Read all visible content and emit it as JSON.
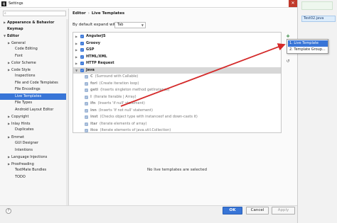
{
  "window": {
    "title": "Settings",
    "app_icon": "IJ"
  },
  "background_tab": {
    "label": "Test02.java"
  },
  "sidebar": {
    "search_placeholder": "",
    "items": [
      {
        "label": "Appearance & Behavior",
        "arrow": "▶",
        "bold": true
      },
      {
        "label": "Keymap",
        "arrow": "",
        "bold": true
      },
      {
        "label": "Editor",
        "arrow": "▼",
        "bold": true
      },
      {
        "label": "General",
        "arrow": "▶",
        "bold": false
      },
      {
        "label": "Code Editing",
        "arrow": "",
        "bold": false
      },
      {
        "label": "Font",
        "arrow": "",
        "bold": false
      },
      {
        "label": "Color Scheme",
        "arrow": "▶",
        "bold": false
      },
      {
        "label": "Code Style",
        "arrow": "▶",
        "bold": false
      },
      {
        "label": "Inspections",
        "arrow": "",
        "bold": false
      },
      {
        "label": "File and Code Templates",
        "arrow": "",
        "bold": false
      },
      {
        "label": "File Encodings",
        "arrow": "",
        "bold": false
      },
      {
        "label": "Live Templates",
        "arrow": "",
        "bold": false,
        "selected": true
      },
      {
        "label": "File Types",
        "arrow": "",
        "bold": false
      },
      {
        "label": "Android Layout Editor",
        "arrow": "",
        "bold": false
      },
      {
        "label": "Copyright",
        "arrow": "▶",
        "bold": false
      },
      {
        "label": "Inlay Hints",
        "arrow": "▶",
        "bold": false
      },
      {
        "label": "Duplicates",
        "arrow": "",
        "bold": false
      },
      {
        "label": "Emmet",
        "arrow": "▶",
        "bold": false
      },
      {
        "label": "GUI Designer",
        "arrow": "",
        "bold": false
      },
      {
        "label": "Intentions",
        "arrow": "",
        "bold": false
      },
      {
        "label": "Language Injections",
        "arrow": "▶",
        "bold": false
      },
      {
        "label": "Proofreading",
        "arrow": "▶",
        "bold": false
      },
      {
        "label": "TextMate Bundles",
        "arrow": "",
        "bold": false
      },
      {
        "label": "TODO",
        "arrow": "",
        "bold": false
      }
    ]
  },
  "main": {
    "breadcrumb_root": "Editor",
    "breadcrumb_sep": "›",
    "breadcrumb_leaf": "Live Templates",
    "expand_label": "By default expand with",
    "expand_value": "Tab",
    "empty_message": "No live templates are selected"
  },
  "templates": [
    {
      "name": "AngularJS",
      "desc": "",
      "arrow": "▶",
      "child": false
    },
    {
      "name": "Groovy",
      "desc": "",
      "arrow": "▶",
      "child": false
    },
    {
      "name": "GSP",
      "desc": "",
      "arrow": "▶",
      "child": false
    },
    {
      "name": "HTML/XML",
      "desc": "",
      "arrow": "▶",
      "child": false
    },
    {
      "name": "HTTP Request",
      "desc": "",
      "arrow": "▶",
      "child": false
    },
    {
      "name": "Java",
      "desc": "",
      "arrow": "▼",
      "child": false,
      "selected": true
    },
    {
      "name": "C",
      "desc": "(Surround with Callable)",
      "arrow": "",
      "child": true
    },
    {
      "name": "fori",
      "desc": "(Create iteration loop)",
      "arrow": "",
      "child": true
    },
    {
      "name": "geti",
      "desc": "(Inserts singleton method getInstance)",
      "arrow": "",
      "child": true
    },
    {
      "name": "I",
      "desc": "(Iterate Iterable | Array)",
      "arrow": "",
      "child": true
    },
    {
      "name": "ifn",
      "desc": "(Inserts 'if null' statement)",
      "arrow": "",
      "child": true
    },
    {
      "name": "inn",
      "desc": "(Inserts 'if not null' statement)",
      "arrow": "",
      "child": true
    },
    {
      "name": "inst",
      "desc": "(Checks object type with instanceof and down-casts it)",
      "arrow": "",
      "child": true
    },
    {
      "name": "itar",
      "desc": "(Iterate elements of array)",
      "arrow": "",
      "child": true
    },
    {
      "name": "itco",
      "desc": "(Iterate elements of java.util.Collection)",
      "arrow": "",
      "child": true
    }
  ],
  "popup": {
    "items": [
      {
        "label": "1. Live Template",
        "active": true
      },
      {
        "label": "2. Template Group...",
        "active": false
      }
    ]
  },
  "footer": {
    "help": "?",
    "ok": "OK",
    "cancel": "Cancel",
    "apply": "Apply"
  },
  "colors": {
    "selection": "#3875d7",
    "checkbox": "#3c78d8",
    "annotation_arrow": "#d42a2a"
  },
  "icons": {
    "add": "plus-icon",
    "remove": "minus-icon",
    "copy": "copy-icon",
    "restore": "restore-icon"
  }
}
